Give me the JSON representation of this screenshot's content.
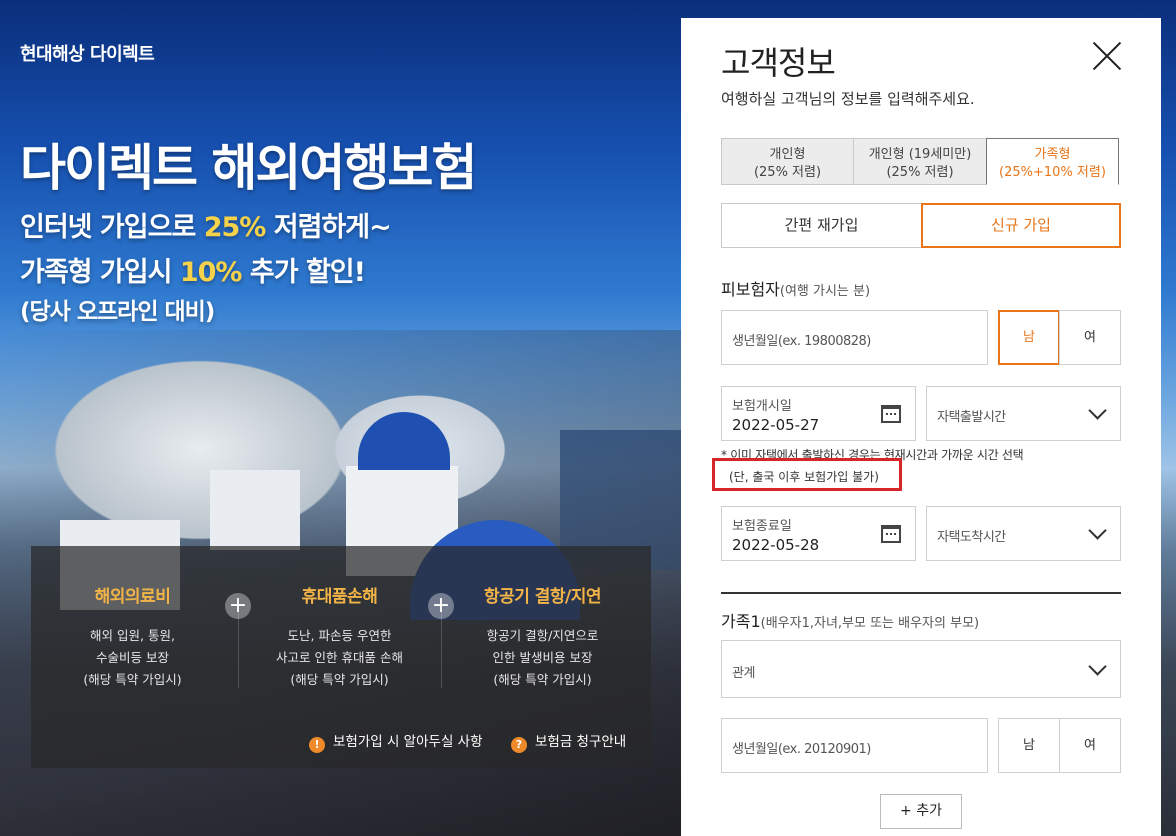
{
  "brand": "현대해상 다이렉트",
  "hero": {
    "title": "다이렉트 해외여행보험",
    "line1_pre": "인터넷 가입으로 ",
    "line1_hl": "25%",
    "line1_post": " 저렴하게~",
    "line2_pre": "가족형 가입시 ",
    "line2_hl": "10%",
    "line2_post": " 추가 할인!",
    "line3": "(당사 오프라인 대비)"
  },
  "benefits": [
    {
      "title": "해외의료비",
      "desc": "해외 입원, 통원,\n수술비등 보장\n(해당 특약 가입시)"
    },
    {
      "title": "휴대품손해",
      "desc": "도난, 파손등 우연한\n사고로 인한 휴대품 손해\n(해당 특약 가입시)"
    },
    {
      "title": "항공기 결항/지연",
      "desc": "항공기 결항/지연으로\n인한 발생비용 보장\n(해당 특약 가입시)"
    }
  ],
  "links": {
    "notice": "보험가입 시 알아두실 사항",
    "claim": "보험금 청구안내"
  },
  "panel": {
    "title": "고객정보",
    "desc": "여행하실 고객님의 정보를 입력해주세요.",
    "tabs": [
      {
        "l1": "개인형",
        "l2": "(25% 저렴)"
      },
      {
        "l1": "개인형 (19세미만)",
        "l2": "(25% 저렴)"
      },
      {
        "l1": "가족형",
        "l2": "(25%+10% 저렴)"
      }
    ],
    "join": {
      "re": "간편 재가입",
      "new": "신규 가입"
    },
    "insured": {
      "label": "피보험자",
      "label_sub": "(여행 가시는 분)"
    },
    "birth_placeholder": "생년월일(ex. 19800828)",
    "male": "남",
    "female": "여",
    "start": {
      "label": "보험개시일",
      "value": "2022-05-27",
      "time": "자택출발시간"
    },
    "note": "* 이미 자택에서 출발하신 경우는 현재시간과 가까운 시간 선택",
    "note2": "(단, 출국 이후 보험가입 불가)",
    "end": {
      "label": "보험종료일",
      "value": "2022-05-28",
      "time": "자택도착시간"
    },
    "family": {
      "label": "가족1",
      "label_sub": "(배우자1,자녀,부모 또는 배우자의 부모)"
    },
    "relation": "관계",
    "family_birth_placeholder": "생년월일(ex. 20120901)",
    "add": "+ 추가"
  }
}
